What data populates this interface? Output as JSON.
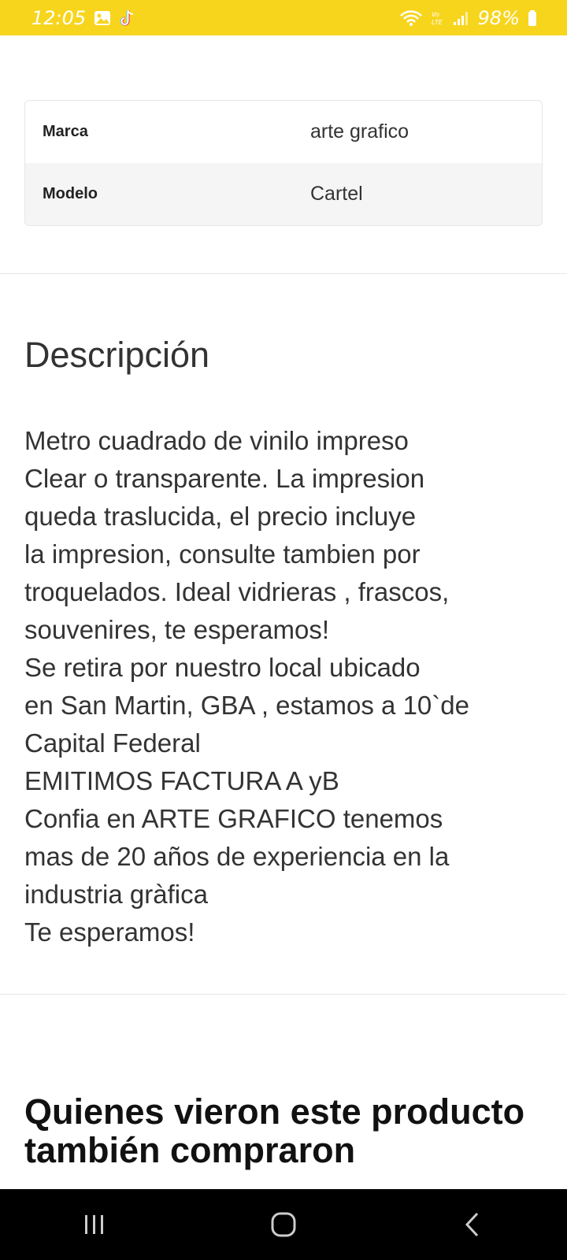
{
  "status_bar": {
    "time": "12:05",
    "battery": "98%",
    "background": "#f7d51d",
    "icons": [
      "image-icon",
      "tiktok-icon",
      "wifi-icon",
      "volte-icon",
      "signal-icon",
      "battery-icon"
    ]
  },
  "specs": [
    {
      "key": "Marca",
      "value": "arte grafico"
    },
    {
      "key": "Modelo",
      "value": "Cartel"
    }
  ],
  "description": {
    "title": "Descripción",
    "text": "Metro cuadrado de vinilo impreso\nClear o transparente. La impresion\nqueda traslucida, el precio incluye\nla impresion, consulte tambien por\ntroquelados. Ideal vidrieras , frascos,\nsouvenires, te esperamos!\nSe retira por nuestro local ubicado\nen San Martin, GBA , estamos a 10`de\nCapital Federal\nEMITIMOS FACTURA A yB\nConfia en ARTE GRAFICO tenemos\nmas de 20 años de experiencia en la\nindustria gràfica\nTe esperamos!"
  },
  "related": {
    "title": "Quienes vieron este producto también compraron"
  },
  "nav_bar": {
    "buttons": [
      "recent-apps-icon",
      "home-icon",
      "back-icon"
    ]
  }
}
